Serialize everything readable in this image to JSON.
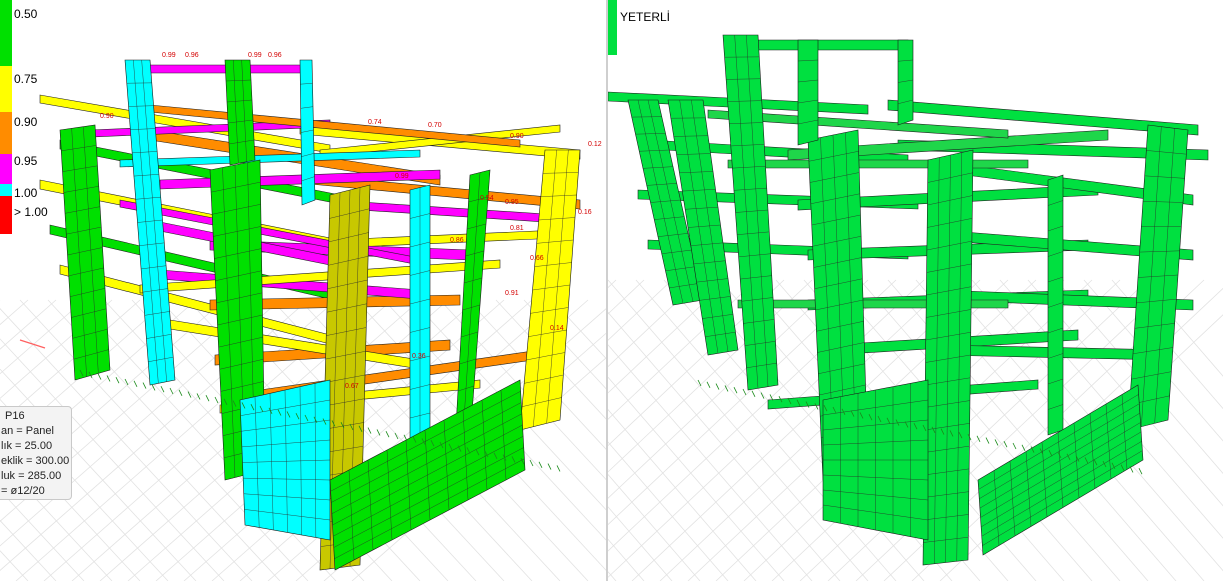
{
  "left_view": {
    "legend": {
      "items": [
        {
          "label": "0.50",
          "color": "#00e000"
        },
        {
          "label": "0.75",
          "color": "#ffff00"
        },
        {
          "label": "0.90",
          "color": "#ff8c00"
        },
        {
          "label": "0.95",
          "color": "#ff00ff"
        },
        {
          "label": "1.00",
          "color": "#00ffff"
        },
        {
          "label": "> 1.00",
          "color": "#ff0000"
        }
      ]
    },
    "ratio_labels": [
      "0.99",
      "0.96",
      "0.99",
      "0.96",
      "0.90",
      "0.74",
      "0.70",
      "0.90",
      "0.12",
      "0.99",
      "0.95",
      "0.81",
      "0.16",
      "0.66",
      "0.86",
      "0.91",
      "0.14",
      "0.36",
      "0.67",
      "0.54"
    ],
    "info_box": {
      "lines": [
        "P16",
        "an = Panel",
        "lık = 25.00",
        "eklik = 300.00",
        "luk = 285.00",
        "= ø12/20"
      ]
    }
  },
  "right_view": {
    "verdict_label": "YETERLİ",
    "verdict_color": "#00e040"
  }
}
